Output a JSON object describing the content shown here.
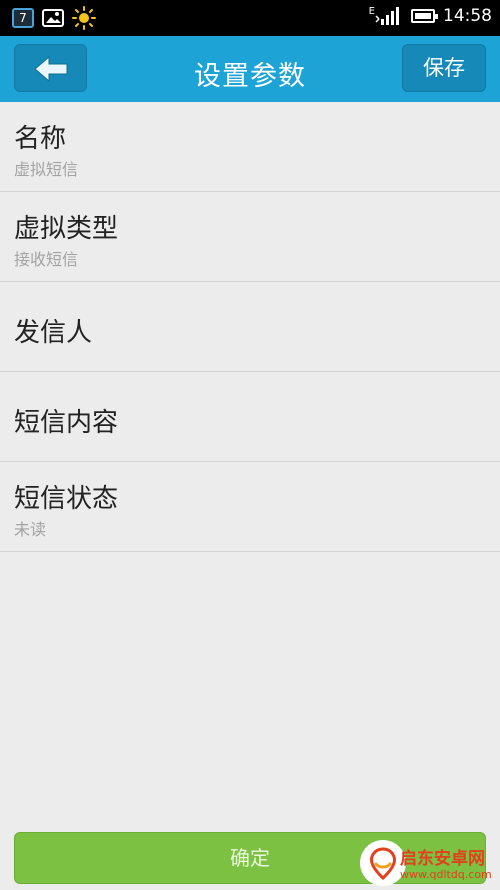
{
  "statusbar": {
    "calendar_day": "7",
    "network_label": "E",
    "time": "14:58"
  },
  "header": {
    "title": "设置参数",
    "save_label": "保存"
  },
  "settings": {
    "items": [
      {
        "label": "名称",
        "value": "虚拟短信"
      },
      {
        "label": "虚拟类型",
        "value": "接收短信"
      },
      {
        "label": "发信人",
        "value": ""
      },
      {
        "label": "短信内容",
        "value": ""
      },
      {
        "label": "短信状态",
        "value": "未读"
      }
    ]
  },
  "footer": {
    "confirm_label": "确定"
  },
  "watermark": {
    "title": "启东安卓网",
    "url": "www.qdltdq.com"
  },
  "colors": {
    "header_bg": "#1ea3d7",
    "header_button_bg": "#1689b8",
    "confirm_bg": "#7cc142",
    "page_bg": "#ececec"
  }
}
